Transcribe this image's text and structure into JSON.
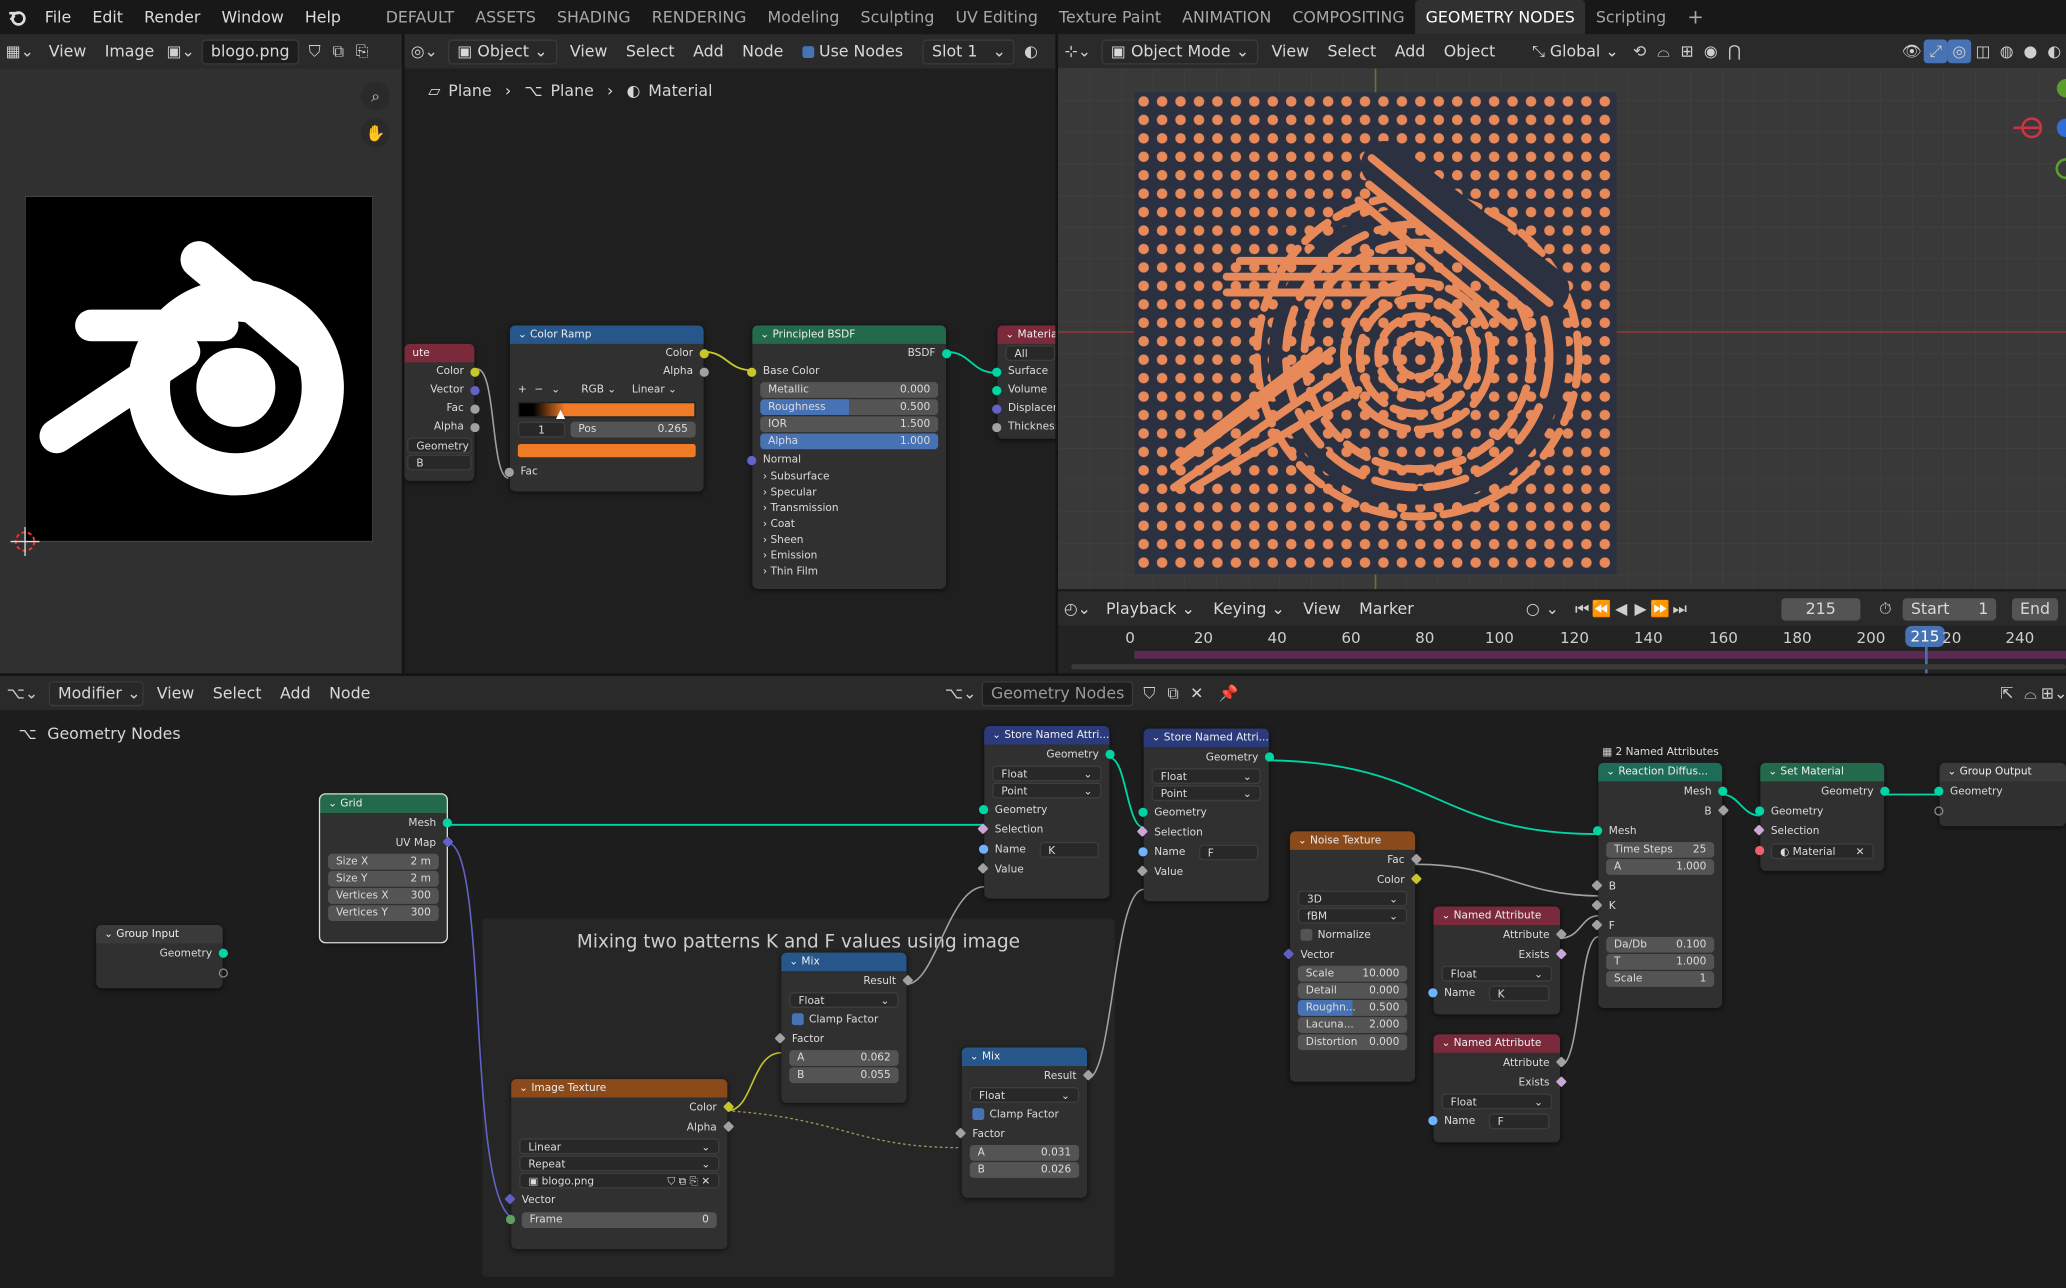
{
  "topbar": {
    "menus": [
      "File",
      "Edit",
      "Render",
      "Window",
      "Help"
    ],
    "workspaces": [
      "DEFAULT",
      "ASSETS",
      "SHADING",
      "RENDERING",
      "Modeling",
      "Sculpting",
      "UV Editing",
      "Texture Paint",
      "ANIMATION",
      "COMPOSITING",
      "GEOMETRY NODES",
      "Scripting"
    ],
    "active_workspace": "GEOMETRY NODES",
    "add_tab": "+"
  },
  "image_editor": {
    "view": "View",
    "image_menu": "Image",
    "image_name": "blogo.png"
  },
  "shader_editor": {
    "type": "Object",
    "menus": [
      "View",
      "Select",
      "Add",
      "Node"
    ],
    "use_nodes": "Use Nodes",
    "slot": "Slot 1",
    "breadcrumb": [
      "Plane",
      "Plane",
      "Material"
    ],
    "nodes": {
      "attr_partial": {
        "title": "ute",
        "outputs": [
          "Color",
          "Vector",
          "Fac",
          "Alpha"
        ],
        "type": "Geometry",
        "name": "B"
      },
      "color_ramp": {
        "title": "Color Ramp",
        "outputs": [
          "Color",
          "Alpha"
        ],
        "mode": "RGB",
        "interp": "Linear",
        "index": "1",
        "pos_label": "Pos",
        "pos": "0.265",
        "input": "Fac"
      },
      "bsdf": {
        "title": "Principled BSDF",
        "output": "BSDF",
        "base": "Base Color",
        "metallic": [
          "Metallic",
          "0.000"
        ],
        "roughness": [
          "Roughness",
          "0.500"
        ],
        "ior": [
          "IOR",
          "1.500"
        ],
        "alpha": [
          "Alpha",
          "1.000"
        ],
        "normal": "Normal",
        "sections": [
          "Subsurface",
          "Specular",
          "Transmission",
          "Coat",
          "Sheen",
          "Emission",
          "Thin Film"
        ]
      },
      "output": {
        "title": "Material O",
        "target": "All",
        "inputs": [
          "Surface",
          "Volume",
          "Displaceme",
          "Thickness"
        ]
      }
    }
  },
  "viewport": {
    "mode": "Object Mode",
    "menus": [
      "View",
      "Select",
      "Add",
      "Object"
    ],
    "orientation": "Global"
  },
  "timeline": {
    "menus": [
      "Playback",
      "Keying",
      "View",
      "Marker"
    ],
    "current_frame": "215",
    "start_label": "Start",
    "start": "1",
    "end_label": "End",
    "ticks": [
      "0",
      "20",
      "40",
      "60",
      "80",
      "100",
      "120",
      "140",
      "160",
      "180",
      "200",
      "215",
      "20",
      "240"
    ]
  },
  "geo_editor": {
    "editor": "Modifier",
    "menus": [
      "View",
      "Select",
      "Add",
      "Node"
    ],
    "tree": "Geometry Nodes",
    "breadcrumb": "Geometry Nodes",
    "frame_label": "Mixing two patterns K and F values using image",
    "named_attr_count": "2 Named Attributes",
    "nodes": {
      "group_input": {
        "title": "Group Input",
        "out": "Geometry"
      },
      "grid": {
        "title": "Grid",
        "outs": [
          "Mesh",
          "UV Map"
        ],
        "fields": [
          [
            "Size X",
            "2 m"
          ],
          [
            "Size Y",
            "2 m"
          ],
          [
            "Vertices X",
            "300"
          ],
          [
            "Vertices Y",
            "300"
          ]
        ]
      },
      "store1": {
        "title": "Store Named Attri...",
        "out": "Geometry",
        "type": "Float",
        "domain": "Point",
        "inputs": [
          "Geometry",
          "Selection"
        ],
        "name_label": "Name",
        "name": "K",
        "value": "Value"
      },
      "store2": {
        "title": "Store Named Attri...",
        "out": "Geometry",
        "type": "Float",
        "domain": "Point",
        "inputs": [
          "Geometry",
          "Selection"
        ],
        "name_label": "Name",
        "name": "F",
        "value": "Value"
      },
      "noise": {
        "title": "Noise Texture",
        "outs": [
          "Fac",
          "Color"
        ],
        "dim": "3D",
        "type": "fBM",
        "normalize": "Normalize",
        "vector": "Vector",
        "fields": [
          [
            "Scale",
            "10.000"
          ],
          [
            "Detail",
            "0.000"
          ],
          [
            "Roughn...",
            "0.500"
          ],
          [
            "Lacuna...",
            "2.000"
          ],
          [
            "Distortion",
            "0.000"
          ]
        ]
      },
      "named1": {
        "title": "Named Attribute",
        "outs": [
          "Attribute",
          "Exists"
        ],
        "type": "Float",
        "name_label": "Name",
        "name": "K"
      },
      "named2": {
        "title": "Named Attribute",
        "outs": [
          "Attribute",
          "Exists"
        ],
        "type": "Float",
        "name_label": "Name",
        "name": "F"
      },
      "reaction": {
        "title": "Reaction Diffus...",
        "outs": [
          "Mesh",
          "B"
        ],
        "mesh_in": "Mesh",
        "fields": [
          [
            "Time Steps",
            "25"
          ],
          [
            "A",
            "1.000"
          ]
        ],
        "inputs": [
          "B",
          "K",
          "F"
        ],
        "fields2": [
          [
            "Da/Db",
            "0.100"
          ],
          [
            "T",
            "1.000"
          ],
          [
            "Scale",
            "1"
          ]
        ]
      },
      "set_material": {
        "title": "Set Material",
        "out": "Geometry",
        "inputs": [
          "Geometry",
          "Selection"
        ],
        "material": "Material"
      },
      "group_output": {
        "title": "Group Output",
        "in": "Geometry"
      },
      "mix1": {
        "title": "Mix",
        "out": "Result",
        "type": "Float",
        "clamp": "Clamp Factor",
        "factor": "Factor",
        "a": [
          "A",
          "0.062"
        ],
        "b": [
          "B",
          "0.055"
        ]
      },
      "mix2": {
        "title": "Mix",
        "out": "Result",
        "type": "Float",
        "clamp": "Clamp Factor",
        "factor": "Factor",
        "a": [
          "A",
          "0.031"
        ],
        "b": [
          "B",
          "0.026"
        ]
      },
      "image_tex": {
        "title": "Image Texture",
        "outs": [
          "Color",
          "Alpha"
        ],
        "interp": "Linear",
        "ext": "Repeat",
        "image": "blogo.png",
        "vector": "Vector",
        "frame": [
          "Frame",
          "0"
        ]
      }
    }
  },
  "colors": {
    "accent": "#4772b3",
    "geometry_socket": "#00d6a3",
    "color_socket": "#c7c729",
    "pattern_orange": "#e8895a",
    "pattern_bg": "#2b3140"
  }
}
